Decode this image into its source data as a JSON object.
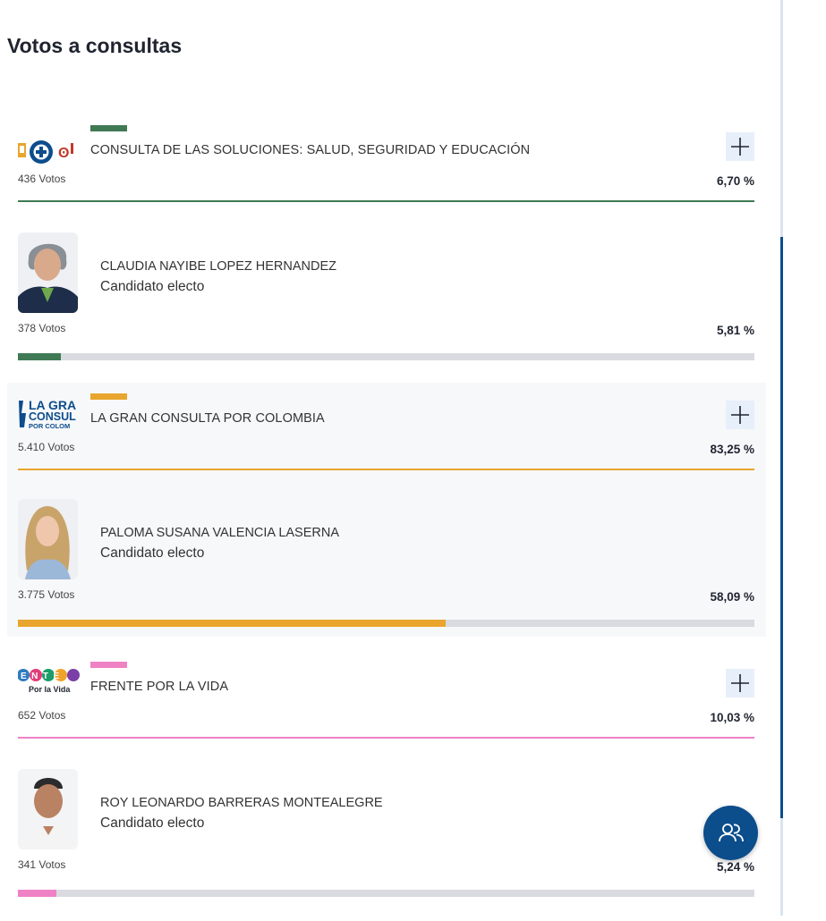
{
  "page": {
    "title": "Votos a consultas"
  },
  "colors": {
    "green": "#3f7a54",
    "orange": "#e9a52d",
    "pink": "#ef82c4",
    "blue": "#0c4d8c"
  },
  "consultas": [
    {
      "party_name": "CONSULTA DE LAS SOLUCIONES: SALUD, SEGURIDAD Y EDUCACIÓN",
      "votes": "436 Votos",
      "percent": "6,70 %",
      "color": "#3f7a54",
      "candidate": {
        "name": "CLAUDIA NAYIBE LOPEZ HERNANDEZ",
        "status": "Candidato electo",
        "votes": "378 Votos",
        "percent": "5,81 %",
        "share": 0.0581
      }
    },
    {
      "party_name": "LA GRAN CONSULTA POR COLOMBIA",
      "logo_text": [
        "LA GRA",
        "CONSUL",
        "POR COLOM"
      ],
      "votes": "5.410 Votos",
      "percent": "83,25 %",
      "color": "#e9a52d",
      "candidate": {
        "name": "PALOMA SUSANA VALENCIA LASERNA",
        "status": "Candidato electo",
        "votes": "3.775 Votos",
        "percent": "58,09 %",
        "share": 0.5809
      }
    },
    {
      "party_name": "FRENTE POR LA VIDA",
      "logo_text": [
        "ENTE",
        "Por la Vida"
      ],
      "votes": "652 Votos",
      "percent": "10,03 %",
      "color": "#ef82c4",
      "candidate": {
        "name": "ROY LEONARDO BARRERAS MONTEALEGRE",
        "status": "Candidato electo",
        "votes": "341 Votos",
        "percent": "5,24 %",
        "share": 0.0524
      }
    }
  ],
  "icons": {
    "expand": "plus-icon",
    "fab": "users-icon"
  }
}
